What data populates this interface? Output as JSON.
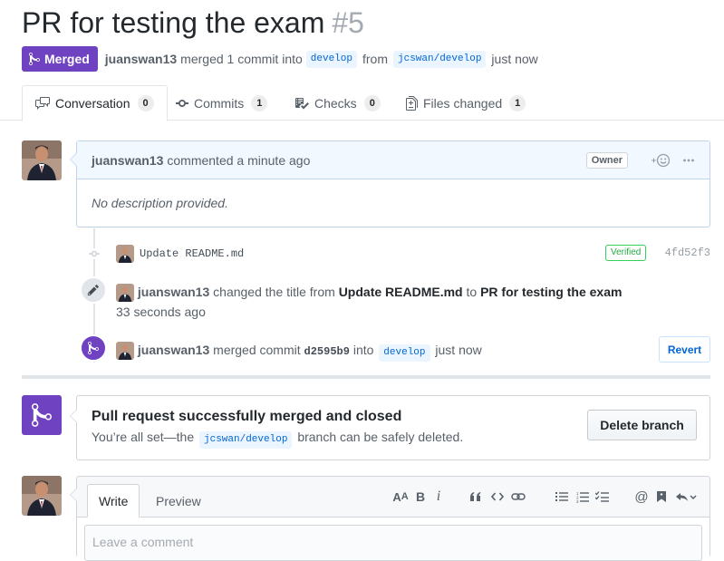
{
  "pr": {
    "title": "PR for testing the exam",
    "number": "#5",
    "state": "Merged",
    "author": "juanswan13",
    "merge_text": "merged 1 commit into",
    "base_branch": "develop",
    "from_text": "from",
    "head_branch": "jcswan/develop",
    "time": "just now"
  },
  "tabs": [
    {
      "label": "Conversation",
      "count": "0",
      "icon": "comment-discussion-icon"
    },
    {
      "label": "Commits",
      "count": "1",
      "icon": "git-commit-icon"
    },
    {
      "label": "Checks",
      "count": "0",
      "icon": "checklist-icon"
    },
    {
      "label": "Files changed",
      "count": "1",
      "icon": "diff-icon"
    }
  ],
  "comment": {
    "author": "juanswan13",
    "action": "commented a minute ago",
    "role": "Owner",
    "reaction_icon": "smiley-icon",
    "menu_icon": "kebab-icon",
    "body": "No description provided."
  },
  "timeline": {
    "commit": {
      "message": "Update README.md",
      "verified": "Verified",
      "sha": "4fd52f3"
    },
    "rename": {
      "actor": "juanswan13",
      "text1": "changed the title from",
      "old_title": "Update README.md",
      "text2": "to",
      "new_title": "PR for testing the exam",
      "time": "33 seconds ago"
    },
    "merge": {
      "actor": "juanswan13",
      "text1": "merged commit",
      "sha": "d2595b9",
      "text2": "into",
      "branch": "develop",
      "time": "just now",
      "revert_label": "Revert"
    }
  },
  "merge_status": {
    "heading": "Pull request successfully merged and closed",
    "desc_before": "You’re all set—the",
    "branch": "jcswan/develop",
    "desc_after": "branch can be safely deleted.",
    "delete_label": "Delete branch"
  },
  "new_comment": {
    "write_tab": "Write",
    "preview_tab": "Preview",
    "placeholder": "Leave a comment",
    "toolbar": [
      "header-icon",
      "bold-icon",
      "italic-icon",
      "quote-icon",
      "code-icon",
      "link-icon",
      "unordered-list-icon",
      "ordered-list-icon",
      "task-list-icon",
      "mention-icon",
      "saved-reply-icon",
      "reply-icon"
    ]
  },
  "colors": {
    "merged_purple": "#6f42c1",
    "link_blue": "#0366d6",
    "verified_green": "#28a745",
    "comment_header_bg": "#f1f8ff"
  }
}
